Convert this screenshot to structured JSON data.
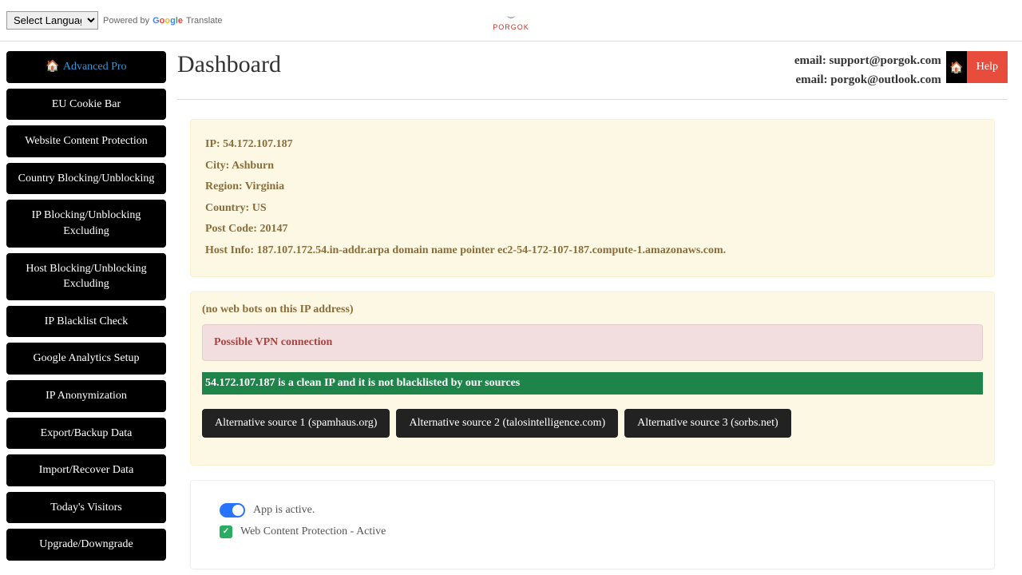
{
  "topbar": {
    "language_placeholder": "Select Language",
    "powered_by": "Powered by",
    "translate": "Translate",
    "brand": "PORGOK"
  },
  "sidebar": {
    "items": [
      "Advanced Pro",
      "EU Cookie Bar",
      "Website Content Protection",
      "Country Blocking/Unblocking",
      "IP Blocking/Unblocking Excluding",
      "Host Blocking/Unblocking Excluding",
      "IP Blacklist Check",
      "Google Analytics Setup",
      "IP Anonymization",
      "Export/Backup Data",
      "Import/Recover Data",
      "Today's Visitors",
      "Upgrade/Downgrade"
    ]
  },
  "header": {
    "title": "Dashboard",
    "email1": "email: support@porgok.com",
    "email2": "email: porgok@outlook.com",
    "help": "Help"
  },
  "ipinfo": {
    "ip_label": "IP: ",
    "ip_value": "54.172.107.187",
    "city_label": "City: ",
    "city_value": "Ashburn",
    "region_label": "Region: ",
    "region_value": "Virginia",
    "country_label": "Country: ",
    "country_value": "US",
    "post_label": "Post Code: ",
    "post_value": "20147",
    "host_label": "Host Info: ",
    "host_value": "187.107.172.54.in-addr.arpa domain name pointer ec2-54-172-107-187.compute-1.amazonaws.com."
  },
  "bots": {
    "note": "(no web bots on this IP address)",
    "vpn": "Possible VPN connection",
    "clean": "54.172.107.187 is a clean IP and it is not blacklisted by our sources",
    "sources": [
      "Alternative source 1 (spamhaus.org)",
      "Alternative source 2 (talosintelligence.com)",
      "Alternative source 3 (sorbs.net)"
    ]
  },
  "status": {
    "active": "App is active.",
    "wcp": "Web Content Protection - Active"
  }
}
